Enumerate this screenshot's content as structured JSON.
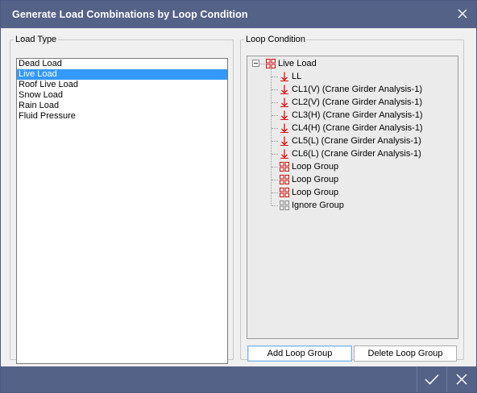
{
  "window": {
    "title": "Generate Load Combinations by Loop Condition",
    "close_icon": "close-icon"
  },
  "load_type": {
    "legend": "Load Type",
    "items": [
      "Dead Load",
      "Live Load",
      "Roof Live Load",
      "Snow Load",
      "Rain Load",
      "Fluid Pressure"
    ],
    "selected": "Live Load"
  },
  "loop_condition": {
    "legend": "Loop Condition",
    "root": {
      "label": "Live Load",
      "icon": "loop-group-icon",
      "expanded": true
    },
    "children": [
      {
        "label": "LL",
        "icon": "load-case-arrow-icon"
      },
      {
        "label": "CL1(V) (Crane Girder Analysis-1)",
        "icon": "load-case-arrow-icon"
      },
      {
        "label": "CL2(V) (Crane Girder Analysis-1)",
        "icon": "load-case-arrow-icon"
      },
      {
        "label": "CL3(H) (Crane Girder Analysis-1)",
        "icon": "load-case-arrow-icon"
      },
      {
        "label": "CL4(H) (Crane Girder Analysis-1)",
        "icon": "load-case-arrow-icon"
      },
      {
        "label": "CL5(L) (Crane Girder Analysis-1)",
        "icon": "load-case-arrow-icon"
      },
      {
        "label": "CL6(L) (Crane Girder Analysis-1)",
        "icon": "load-case-arrow-icon"
      },
      {
        "label": "Loop Group",
        "icon": "loop-group-icon"
      },
      {
        "label": "Loop Group",
        "icon": "loop-group-icon"
      },
      {
        "label": "Loop Group",
        "icon": "loop-group-icon"
      },
      {
        "label": "Ignore Group",
        "icon": "ignore-group-icon"
      }
    ],
    "add_button": "Add Loop Group",
    "delete_button": "Delete Loop Group"
  },
  "footer": {
    "ok_icon": "checkmark-icon",
    "cancel_icon": "close-icon"
  },
  "colors": {
    "titlebar": "#556287",
    "selection": "#3399ff",
    "load_case_red": "#e01010",
    "group_red": "#d01010",
    "ignore_gray": "#8a8a8a"
  }
}
